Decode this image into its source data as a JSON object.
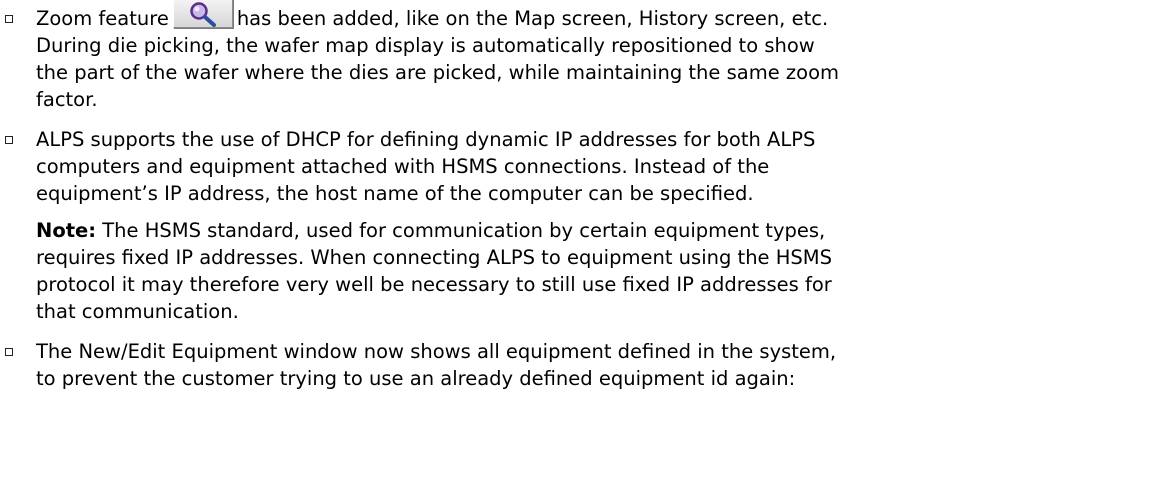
{
  "bullets": [
    {
      "lines": [
        {
          "before_icon": "Zoom feature",
          "after_icon": "has been added, like on the Map screen, History screen, etc."
        },
        "During die picking, the wafer map display is automatically repositioned to show",
        "the part of the wafer where the dies are picked, while maintaining the same zoom",
        "factor."
      ],
      "icon": "magnifier-zoom-icon"
    },
    {
      "lines": [
        "ALPS supports the use of DHCP for defining dynamic IP addresses for both ALPS",
        "computers and equipment attached with HSMS connections. Instead of the",
        "equipment’s IP address, the host name of the computer can be specified."
      ],
      "note": {
        "label": "Note:",
        "first_line_rest": " The HSMS standard, used for communication by certain equipment types,",
        "lines": [
          "requires fixed IP addresses. When connecting ALPS to equipment using the HSMS",
          "protocol it may therefore very well be necessary to still use fixed IP addresses for",
          "that communication."
        ]
      }
    },
    {
      "lines": [
        "The New/Edit Equipment window now shows all equipment defined in the system,",
        "to prevent the customer trying to use an already defined equipment id again:"
      ]
    }
  ]
}
